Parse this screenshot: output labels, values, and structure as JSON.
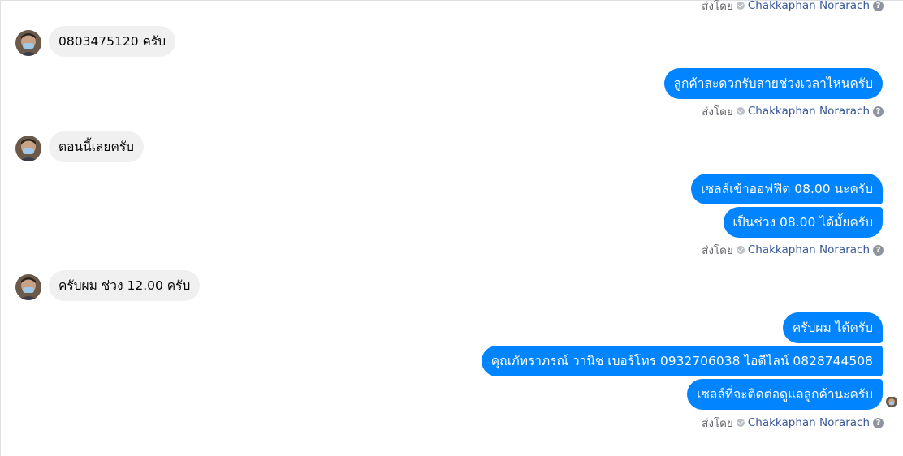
{
  "thread": {
    "sent_by_label": "ส่งโดย",
    "sender_name": "Chakkaphan Norarach",
    "help_glyph": "?",
    "customer_messages": [
      "0803475120 ครับ",
      "ตอนนี้เลยครับ",
      "ครับผม ช่วง 12.00 ครับ"
    ],
    "page_messages": [
      "ลูกค้าสะดวกรับสายช่วงเวลาไหนครับ",
      "เซลล์เข้าออฟฟิต 08.00 นะครับ",
      "เป็นช่วง 08.00 ได้มั้ยครับ",
      "ครับผม ได้ครับ",
      "คุณภัทราภรณ์  วานิช      เบอร์โทร 0932706038  ไอดีไลน์ 0828744508",
      "เซลล์ที่จะติดต่อดูแลลูกค้านะครับ"
    ]
  },
  "colors": {
    "outgoing_bubble": "#0084ff",
    "incoming_bubble": "#f0f0f0",
    "sender_link": "#385898",
    "meta_text": "#65676b"
  }
}
